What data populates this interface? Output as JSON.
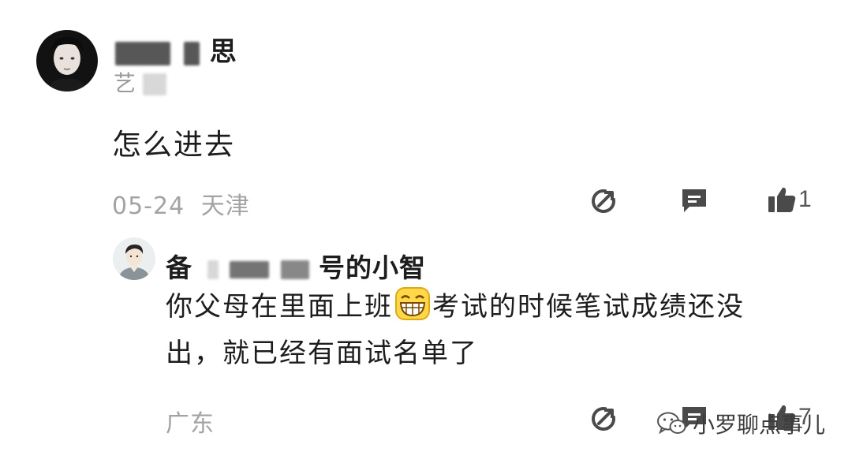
{
  "comment": {
    "author_name_visible": "思",
    "author_sub_visible": "艺",
    "text": "怎么进去",
    "date": "05-24",
    "location": "天津",
    "like_count": "1",
    "icons": {
      "share": "share-icon",
      "reply": "reply-icon",
      "like": "thumbs-up-icon"
    }
  },
  "reply": {
    "author_prefix": "备",
    "author_suffix": "号的小智",
    "text_before_emoji": "你父母在里面上班",
    "emoji": "grinning-emoji",
    "text_after_emoji": "考试的时候笔试成绩还没",
    "text_line2": "出，就已经有面试名单了",
    "location": "广东",
    "like_count": "7"
  },
  "watermark": {
    "text": "小罗聊点事儿",
    "icon": "wechat-icon"
  },
  "colors": {
    "text": "#1d1d1d",
    "meta": "#a3a3a3",
    "icon": "#4a4a4a"
  }
}
